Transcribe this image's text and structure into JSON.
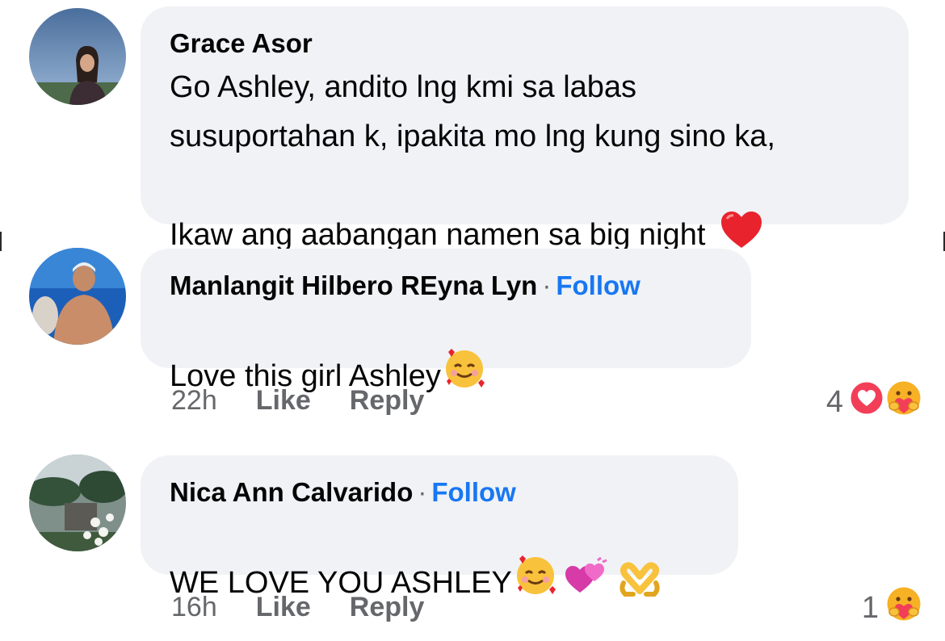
{
  "comments": [
    {
      "author": "Grace Asor",
      "text": "Go Ashley, andito lng kmi sa labas\nsusuportahan k, ipakita mo lng kung sino ka,\nIkaw ang aabangan namen sa big night",
      "emojis": [
        "heart-emoji"
      ]
    },
    {
      "author": "Manlangit Hilbero REyna Lyn",
      "separator": "·",
      "follow": "Follow",
      "text": "Love this girl Ashley",
      "emojis": [
        "smiling-face-with-hearts-emoji"
      ],
      "time": "22h",
      "like": "Like",
      "reply": "Reply",
      "reaction_count": "4",
      "reactions": [
        "love-reaction-icon",
        "care-reaction-icon"
      ]
    },
    {
      "author": "Nica Ann Calvarido",
      "separator": "·",
      "follow": "Follow",
      "text": "WE LOVE YOU ASHLEY",
      "emojis": [
        "smiling-face-with-hearts-emoji",
        "two-hearts-emoji",
        "heart-hands-emoji"
      ],
      "time": "16h",
      "like": "Like",
      "reply": "Reply",
      "reaction_count": "1",
      "reactions": [
        "care-reaction-icon"
      ]
    }
  ],
  "colors": {
    "bubble": "#f0f2f5",
    "link": "#1877f2",
    "meta": "#65676b",
    "love": "#f33e58",
    "care": "#f7b125"
  }
}
